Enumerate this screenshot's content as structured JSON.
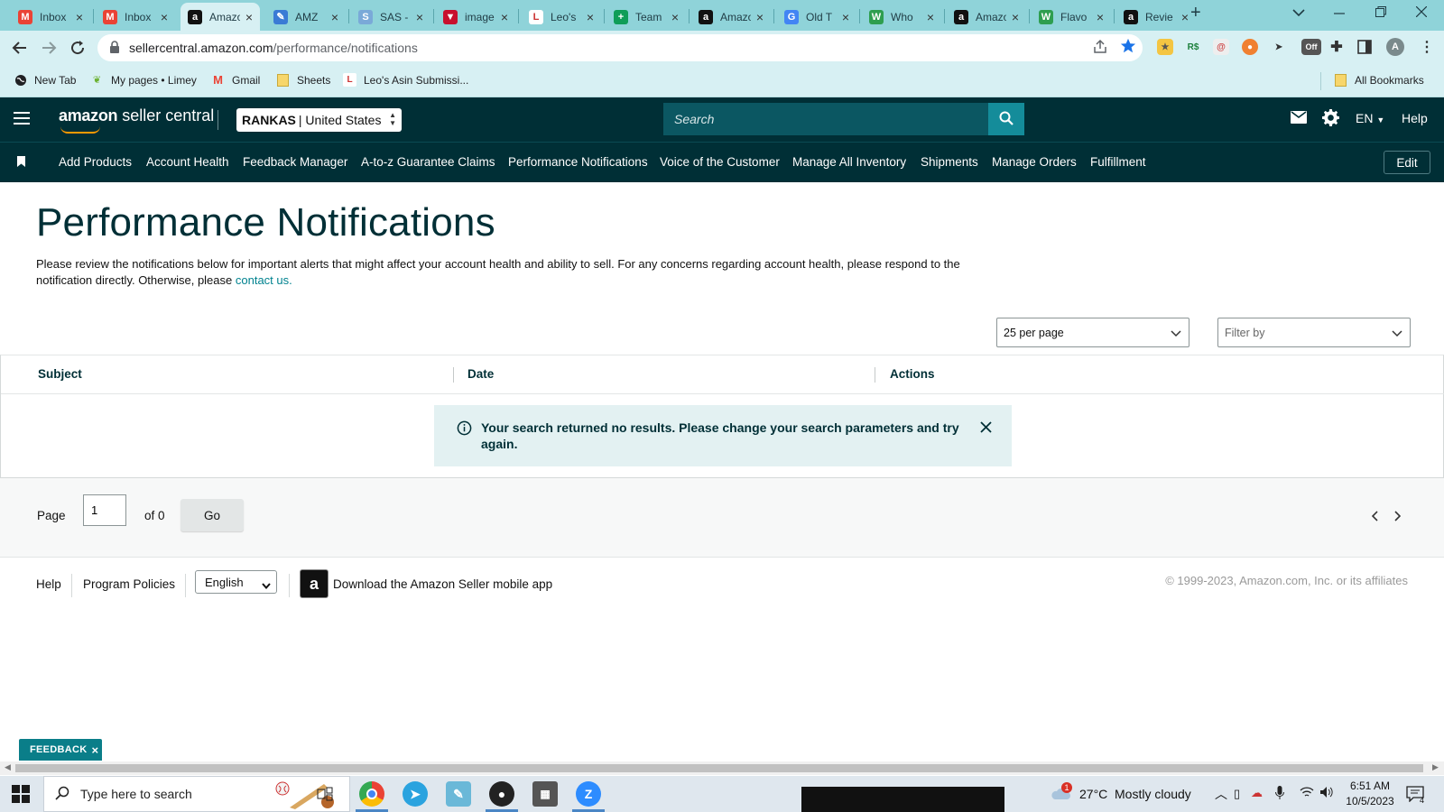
{
  "browser": {
    "tabs": [
      {
        "title": "Inbox",
        "icon": "gmail-icon",
        "color": "#ea4335",
        "glyph": "M",
        "active": false
      },
      {
        "title": "Inbox",
        "icon": "gmail-icon",
        "color": "#ea4335",
        "glyph": "M",
        "active": false
      },
      {
        "title": "Amazon",
        "icon": "amazon-icon",
        "color": "#111111",
        "glyph": "a",
        "active": true
      },
      {
        "title": "AMZ",
        "icon": "pen-icon",
        "color": "#3a7bd5",
        "glyph": "✎",
        "active": false
      },
      {
        "title": "SAS -",
        "icon": "sas-icon",
        "color": "#7aa9d8",
        "glyph": "S",
        "active": false
      },
      {
        "title": "image",
        "icon": "vbar-icon",
        "color": "#c8102e",
        "glyph": "▼",
        "active": false
      },
      {
        "title": "Leo's",
        "icon": "leo-icon",
        "color": "#ffffff",
        "glyph": "L",
        "active": false
      },
      {
        "title": "Team",
        "icon": "sheets-plus-icon",
        "color": "#0f9d58",
        "glyph": "+",
        "active": false
      },
      {
        "title": "Amazon",
        "icon": "amazon-icon",
        "color": "#111111",
        "glyph": "a",
        "active": false
      },
      {
        "title": "Old T",
        "icon": "google-icon",
        "color": "#4285f4",
        "glyph": "G",
        "active": false
      },
      {
        "title": "Who",
        "icon": "w-icon",
        "color": "#2e9e4f",
        "glyph": "W",
        "active": false
      },
      {
        "title": "Amazon",
        "icon": "amazon-icon",
        "color": "#111111",
        "glyph": "a",
        "active": false
      },
      {
        "title": "Flavo",
        "icon": "w-icon",
        "color": "#2e9e4f",
        "glyph": "W",
        "active": false
      },
      {
        "title": "Revie",
        "icon": "amazon-icon",
        "color": "#111111",
        "glyph": "a",
        "active": false
      }
    ],
    "url_host": "sellercentral.amazon.com",
    "url_path": "/performance/notifications",
    "profile_initial": "A",
    "ext_off_label": "Off",
    "bookmarks": [
      {
        "label": "New Tab",
        "icon": "globe-icon"
      },
      {
        "label": "My pages • Limey",
        "icon": "leaf-icon"
      },
      {
        "label": "Gmail",
        "icon": "gmail-icon"
      },
      {
        "label": "Sheets",
        "icon": "folder-icon"
      },
      {
        "label": "Leo's Asin Submissi...",
        "icon": "leo-icon"
      }
    ],
    "all_bookmarks": "All Bookmarks"
  },
  "header": {
    "logo_bold": "amazon",
    "logo_rest": " seller central",
    "account_name": "RANKAS",
    "account_region": "| United States",
    "search_placeholder": "Search",
    "language": "EN",
    "help": "Help"
  },
  "nav": {
    "items": [
      "Add Products",
      "Account Health",
      "Feedback Manager",
      "A-to-z Guarantee Claims",
      "Performance Notifications",
      "Voice of the Customer",
      "Manage All Inventory",
      "Shipments",
      "Manage Orders",
      "Fulfillment"
    ],
    "edit": "Edit"
  },
  "main": {
    "title": "Performance Notifications",
    "description": "Please review the notifications below for important alerts that might affect your account health and ability to sell. For any concerns regarding account health, please respond to the notification directly. Otherwise, please ",
    "contact_link": "contact us.",
    "per_page": "25 per page",
    "filter_placeholder": "Filter by",
    "columns": [
      "Subject",
      "Date",
      "Actions"
    ],
    "alert_message": "Your search returned no results. Please change your search parameters and try again.",
    "pager": {
      "label": "Page",
      "value": "1",
      "of": "of 0",
      "go": "Go"
    }
  },
  "footer": {
    "help": "Help",
    "policies": "Program Policies",
    "language": "English",
    "app_text": "Download the Amazon Seller mobile app",
    "copyright": "© 1999-2023, Amazon.com, Inc. or its affiliates"
  },
  "feedback": "FEEDBACK",
  "taskbar": {
    "search_placeholder": "Type here to search",
    "weather_badge": "1",
    "temperature": "27°C",
    "weather": "Mostly cloudy",
    "time": "6:51 AM",
    "date": "10/5/2023",
    "notif_count": "4"
  },
  "colors": {
    "header_bg": "#002f36",
    "accent_teal": "#148c9a",
    "alert_bg": "#e3f1f2",
    "tabstrip": "#8fd3d9"
  }
}
